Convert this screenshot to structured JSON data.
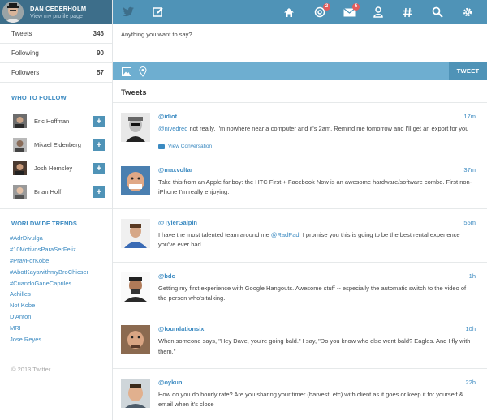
{
  "profile": {
    "name": "DAN CEDERHOLM",
    "link": "View my profile page"
  },
  "stats": [
    {
      "label": "Tweets",
      "value": "346"
    },
    {
      "label": "Following",
      "value": "90"
    },
    {
      "label": "Followers",
      "value": "57"
    }
  ],
  "who_to_follow": {
    "title": "WHO TO FOLLOW",
    "users": [
      {
        "name": "Eric Hoffman",
        "button": "+"
      },
      {
        "name": "Mikael Eidenberg",
        "button": "+"
      },
      {
        "name": "Josh Hemsley",
        "button": "+"
      },
      {
        "name": "Brian Hoff",
        "button": "+"
      }
    ]
  },
  "trends": {
    "title": "WORLDWIDE TRENDS",
    "items": [
      "#AdrDivulga",
      "#10MotivosParaSerFeliz",
      "#PrayForKobe",
      "#AbotKayawithmyBroChicser",
      "#CuandoGaneCapriles",
      "Achilles",
      "Not Kobe",
      "D'Antoni",
      "MRI",
      "Jose Reyes"
    ]
  },
  "footer": "© 2013 Twitter",
  "nav": {
    "badges": {
      "mentions": "2",
      "messages": "5"
    }
  },
  "compose": {
    "placeholder": "Anything you want to say?",
    "tweet_label": "TWEET"
  },
  "feed": {
    "title": "Tweets",
    "tweets": [
      {
        "user": "@idiot",
        "time": "17m",
        "mention": "@nivedred",
        "text": " not really. I'm nowhere near a computer and it's 2am. Remind me tomorrow and I'll get an export for you",
        "conversation": "View Conversation"
      },
      {
        "user": "@maxvoltar",
        "time": "37m",
        "mention": "",
        "text": "Take this from an Apple fanboy: the HTC First + Facebook Now is an awesome hardware/software combo. First non-iPhone I'm really enjoying."
      },
      {
        "user": "@TylerGalpin",
        "time": "55m",
        "text_before": "I have the most talented team around me ",
        "mention": "@RadPad",
        "text_after": ". I promise you this is going to be the best rental experience you've ever had."
      },
      {
        "user": "@bdc",
        "time": "1h",
        "mention": "",
        "text": "Getting my first experience with Google Hangouts. Awesome stuff -- especially the automatic switch to the video of the person who's talking."
      },
      {
        "user": "@foundationsix",
        "time": "10h",
        "mention": "",
        "text": "When someone says, \"Hey Dave, you're going bald.\" I say, \"Do you know who else went bald? Eagles. And I fly with them.\""
      },
      {
        "user": "@oykun",
        "time": "22h",
        "mention": "",
        "text": "How do you do hourly rate? Are you sharing your timer (harvest, etc) with client as it goes or keep it for yourself & email when it's close"
      }
    ]
  },
  "colors": {
    "nav": "#4f93b7",
    "profile_bar": "#3d6e8a",
    "link": "#3b8ac1",
    "badge": "#e25c5c"
  },
  "icons": [
    "bird-icon",
    "compose-icon",
    "home-icon",
    "mentions-icon",
    "messages-icon",
    "profile-icon",
    "hashtag-icon",
    "search-icon",
    "settings-icon",
    "image-icon",
    "location-icon",
    "conversation-icon",
    "plus-icon"
  ]
}
